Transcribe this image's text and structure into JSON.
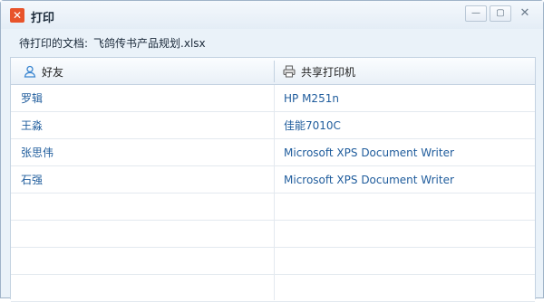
{
  "window": {
    "title": "打印",
    "app_icon_glyph": "✕",
    "controls": {
      "minimize": "—",
      "maximize": "▢",
      "close": "✕"
    }
  },
  "document": {
    "label": "待打印的文档:",
    "name": "飞鸽传书产品规划.xlsx"
  },
  "table": {
    "columns": [
      {
        "label": "好友",
        "icon": "user-icon"
      },
      {
        "label": "共享打印机",
        "icon": "printer-icon"
      }
    ],
    "rows": [
      {
        "friend": "罗辑",
        "printer": "HP M251n"
      },
      {
        "friend": "王淼",
        "printer": "佳能7010C"
      },
      {
        "friend": "张思伟",
        "printer": "Microsoft XPS Document Writer"
      },
      {
        "friend": "石强",
        "printer": "Microsoft XPS Document Writer"
      }
    ]
  },
  "colors": {
    "accent": "#1f5c9c",
    "app_icon": "#e8532a",
    "border": "#c3d2e1"
  }
}
